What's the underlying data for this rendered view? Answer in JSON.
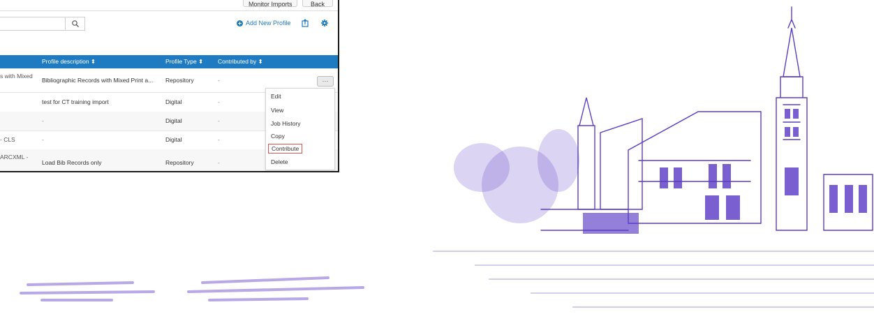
{
  "toolbar": {
    "monitor_label": "Monitor Imports",
    "back_label": "Back"
  },
  "search": {
    "value": "",
    "placeholder": ""
  },
  "actions": {
    "add_profile_label": "Add New Profile"
  },
  "table": {
    "columns": {
      "description": "Profile description ⬍",
      "type": "Profile Type ⬍",
      "contributed_by": "Contributed by ⬍"
    },
    "rows": [
      {
        "name": "s with Mixed",
        "description": "Bibliographic Records with Mixed Print a...",
        "type": "Repository",
        "contributed_by": "-"
      },
      {
        "name": "",
        "description": "test for CT training import",
        "type": "Digital",
        "contributed_by": "-"
      },
      {
        "name": "",
        "description": "-",
        "type": "Digital",
        "contributed_by": "-"
      },
      {
        "name": "- CLS",
        "description": "-",
        "type": "Digital",
        "contributed_by": "-"
      },
      {
        "name": "ARCXML -",
        "description": "Load Bib Records only",
        "type": "Repository",
        "contributed_by": "-"
      }
    ]
  },
  "row_menu": {
    "trigger_label": "···",
    "items": [
      "Edit",
      "View",
      "Job History",
      "Copy",
      "Contribute",
      "Delete"
    ],
    "highlighted": "Contribute"
  },
  "colors": {
    "header_bg": "#1f7bc1",
    "accent": "#1f7bc1",
    "illustration_purple": "#5b3cc4",
    "highlight_border": "#d9534f"
  },
  "icons": [
    "search-icon",
    "plus-icon",
    "export-icon",
    "gear-icon",
    "ellipsis-icon"
  ]
}
